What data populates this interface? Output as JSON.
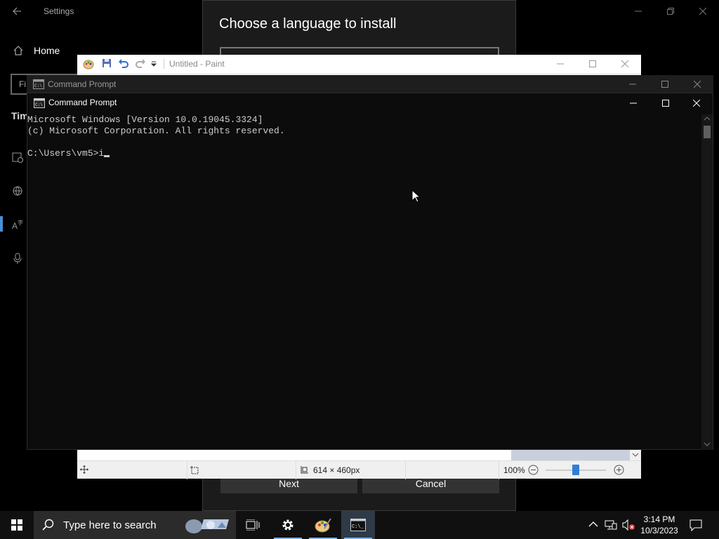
{
  "settings": {
    "title": "Settings",
    "home_label": "Home",
    "find_placeholder": "Fi",
    "section_partial": "Tim"
  },
  "language_dialog": {
    "heading": "Choose a language to install",
    "next_label": "Next",
    "cancel_label": "Cancel"
  },
  "paint": {
    "title": "Untitled - Paint",
    "canvas_size": "614 × 460px",
    "zoom": "100%"
  },
  "cmd_back": {
    "title": "Command Prompt"
  },
  "cmd": {
    "title": "Command Prompt",
    "lines": [
      "Microsoft Windows [Version 10.0.19045.3324]",
      "(c) Microsoft Corporation. All rights reserved.",
      "",
      "C:\\Users\\vm5>i"
    ]
  },
  "taskbar": {
    "search_placeholder": "Type here to search",
    "time": "3:14 PM",
    "date": "10/3/2023"
  },
  "colors": {
    "accent": "#4a8fd8",
    "console_bg": "#0c0c0c",
    "console_text": "#cccccc"
  }
}
